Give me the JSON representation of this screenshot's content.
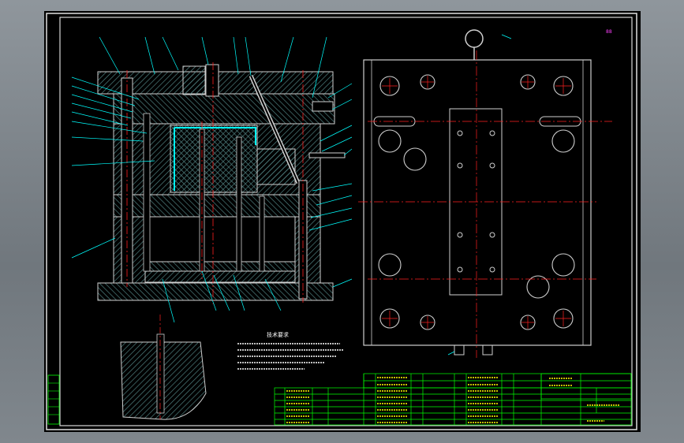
{
  "colors": {
    "frame": "#e0e0e0",
    "border": "#d8d8d8",
    "leader": "#00ffff",
    "center": "#ff2020",
    "hatch": "#5a8a8a",
    "dim": "#00ff00",
    "title_text": "#ffff00",
    "magenta": "#ff40ff"
  },
  "drawing": {
    "notes_heading": "技术要求",
    "corner_mark": "88"
  },
  "icons": [
    "hatch-pattern",
    "center-line",
    "leader-line"
  ]
}
